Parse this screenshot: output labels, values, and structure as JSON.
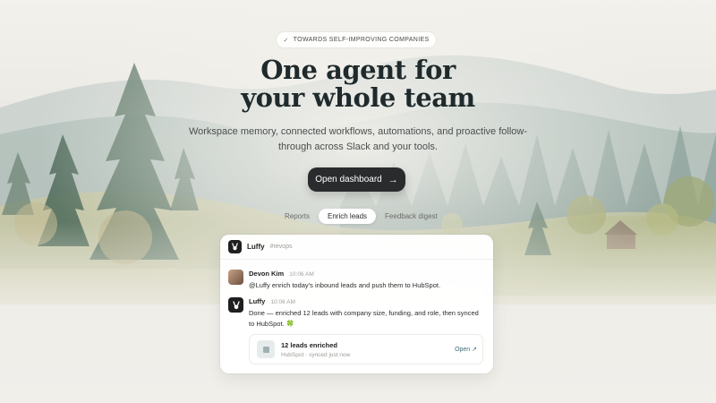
{
  "announcement": {
    "check_icon": "check-icon",
    "text": "TOWARDS SELF-IMPROVING COMPANIES"
  },
  "hero": {
    "title_line1": "One agent for",
    "title_line2": "your whole team",
    "subtitle": "Workspace memory, connected workflows, automations, and proactive follow-through across Slack and your tools.",
    "cta_label": "Open dashboard",
    "cta_icon": "arrow-right-icon"
  },
  "tabs": [
    {
      "label": "Reports",
      "active": false
    },
    {
      "label": "Enrich leads",
      "active": true
    },
    {
      "label": "Feedback digest",
      "active": false
    }
  ],
  "chat": {
    "app_name": "Luffy",
    "channel": "#revops",
    "messages": [
      {
        "author": "Devon Kim",
        "time": "10:06 AM",
        "text": "@Luffy enrich today's inbound leads and push them to HubSpot."
      },
      {
        "author": "Luffy",
        "time": "10:06 AM",
        "text": "Done — enriched 12 leads with company size, funding, and role, then synced to HubSpot. 🍀"
      }
    ],
    "attachment": {
      "title": "12 leads enriched",
      "subtitle": "HubSpot · synced just now",
      "action": "Open ↗"
    }
  },
  "colors": {
    "cta_bg": "#2a2b2c",
    "title": "#1f2a2c",
    "link": "#3f6b76"
  }
}
